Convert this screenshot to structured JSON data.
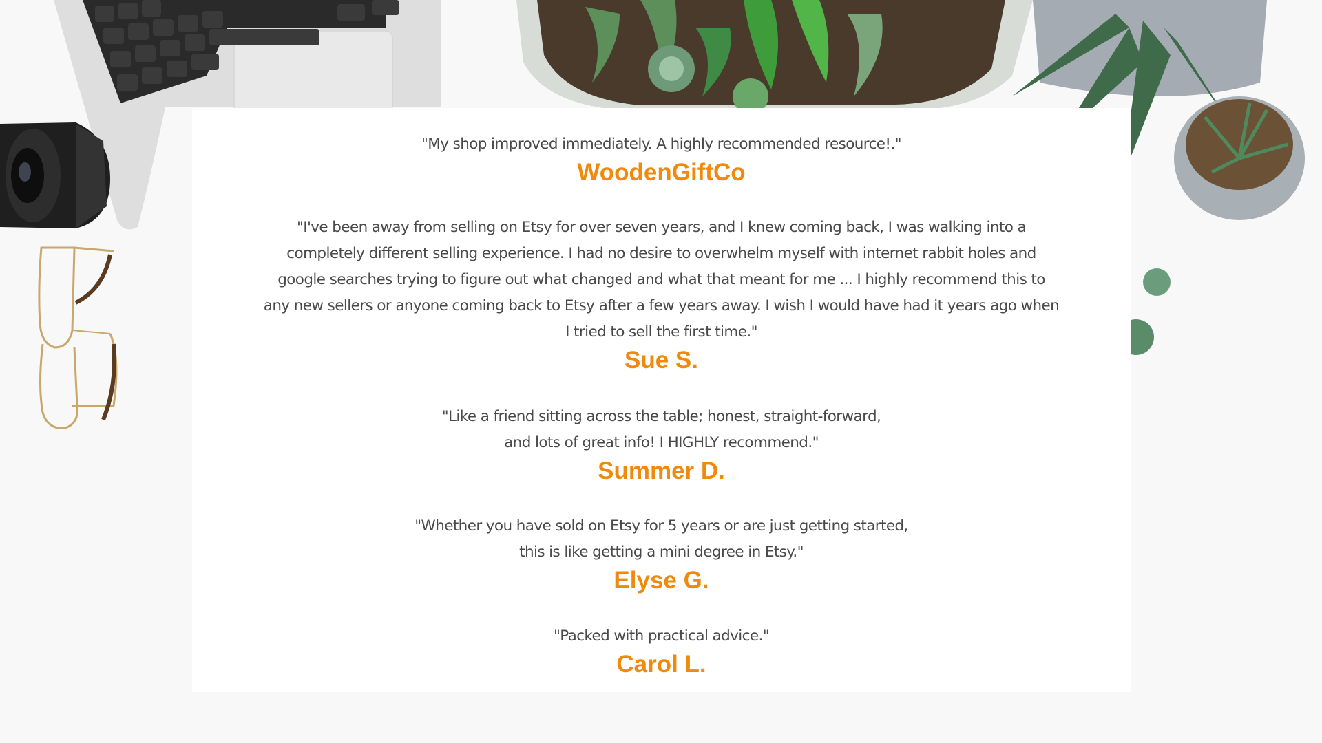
{
  "testimonials": [
    {
      "quote": "\"My shop improved immediately.  A highly recommended resource!.\"",
      "author": "WoodenGiftCo"
    },
    {
      "quote_lines": [
        "\"I've been away from selling on Etsy for over seven years, and I knew coming back, I was walking into a",
        "completely different selling experience. I had no desire to overwhelm myself with internet rabbit holes and",
        "google searches trying to figure out what changed and what that meant for me ... I highly recommend this to",
        "any new sellers or anyone coming back to Etsy after a few years away. I wish I would have had it years ago when",
        "I tried to sell the first time.\""
      ],
      "author": "Sue S."
    },
    {
      "quote_lines": [
        "\"Like a friend sitting across the table; honest, straight-forward,",
        "and lots of great info! I HIGHLY recommend.\""
      ],
      "author": "Summer D."
    },
    {
      "quote_lines": [
        "\"Whether you have sold on Etsy for 5 years or are just getting started,",
        "this is like getting a mini degree in Etsy.\""
      ],
      "author": "Elyse G."
    },
    {
      "quote": "\"Packed with practical advice.\"",
      "author": "Carol L."
    }
  ],
  "colors": {
    "author_accent": "#ef8a0c",
    "quote_text": "#4a4a4a",
    "card_background": "#ffffff"
  },
  "decor": {
    "items": [
      "laptop-keyboard",
      "camera-lens",
      "eyeglasses",
      "succulent-terrarium",
      "potted-aloe",
      "potted-succulent"
    ]
  }
}
